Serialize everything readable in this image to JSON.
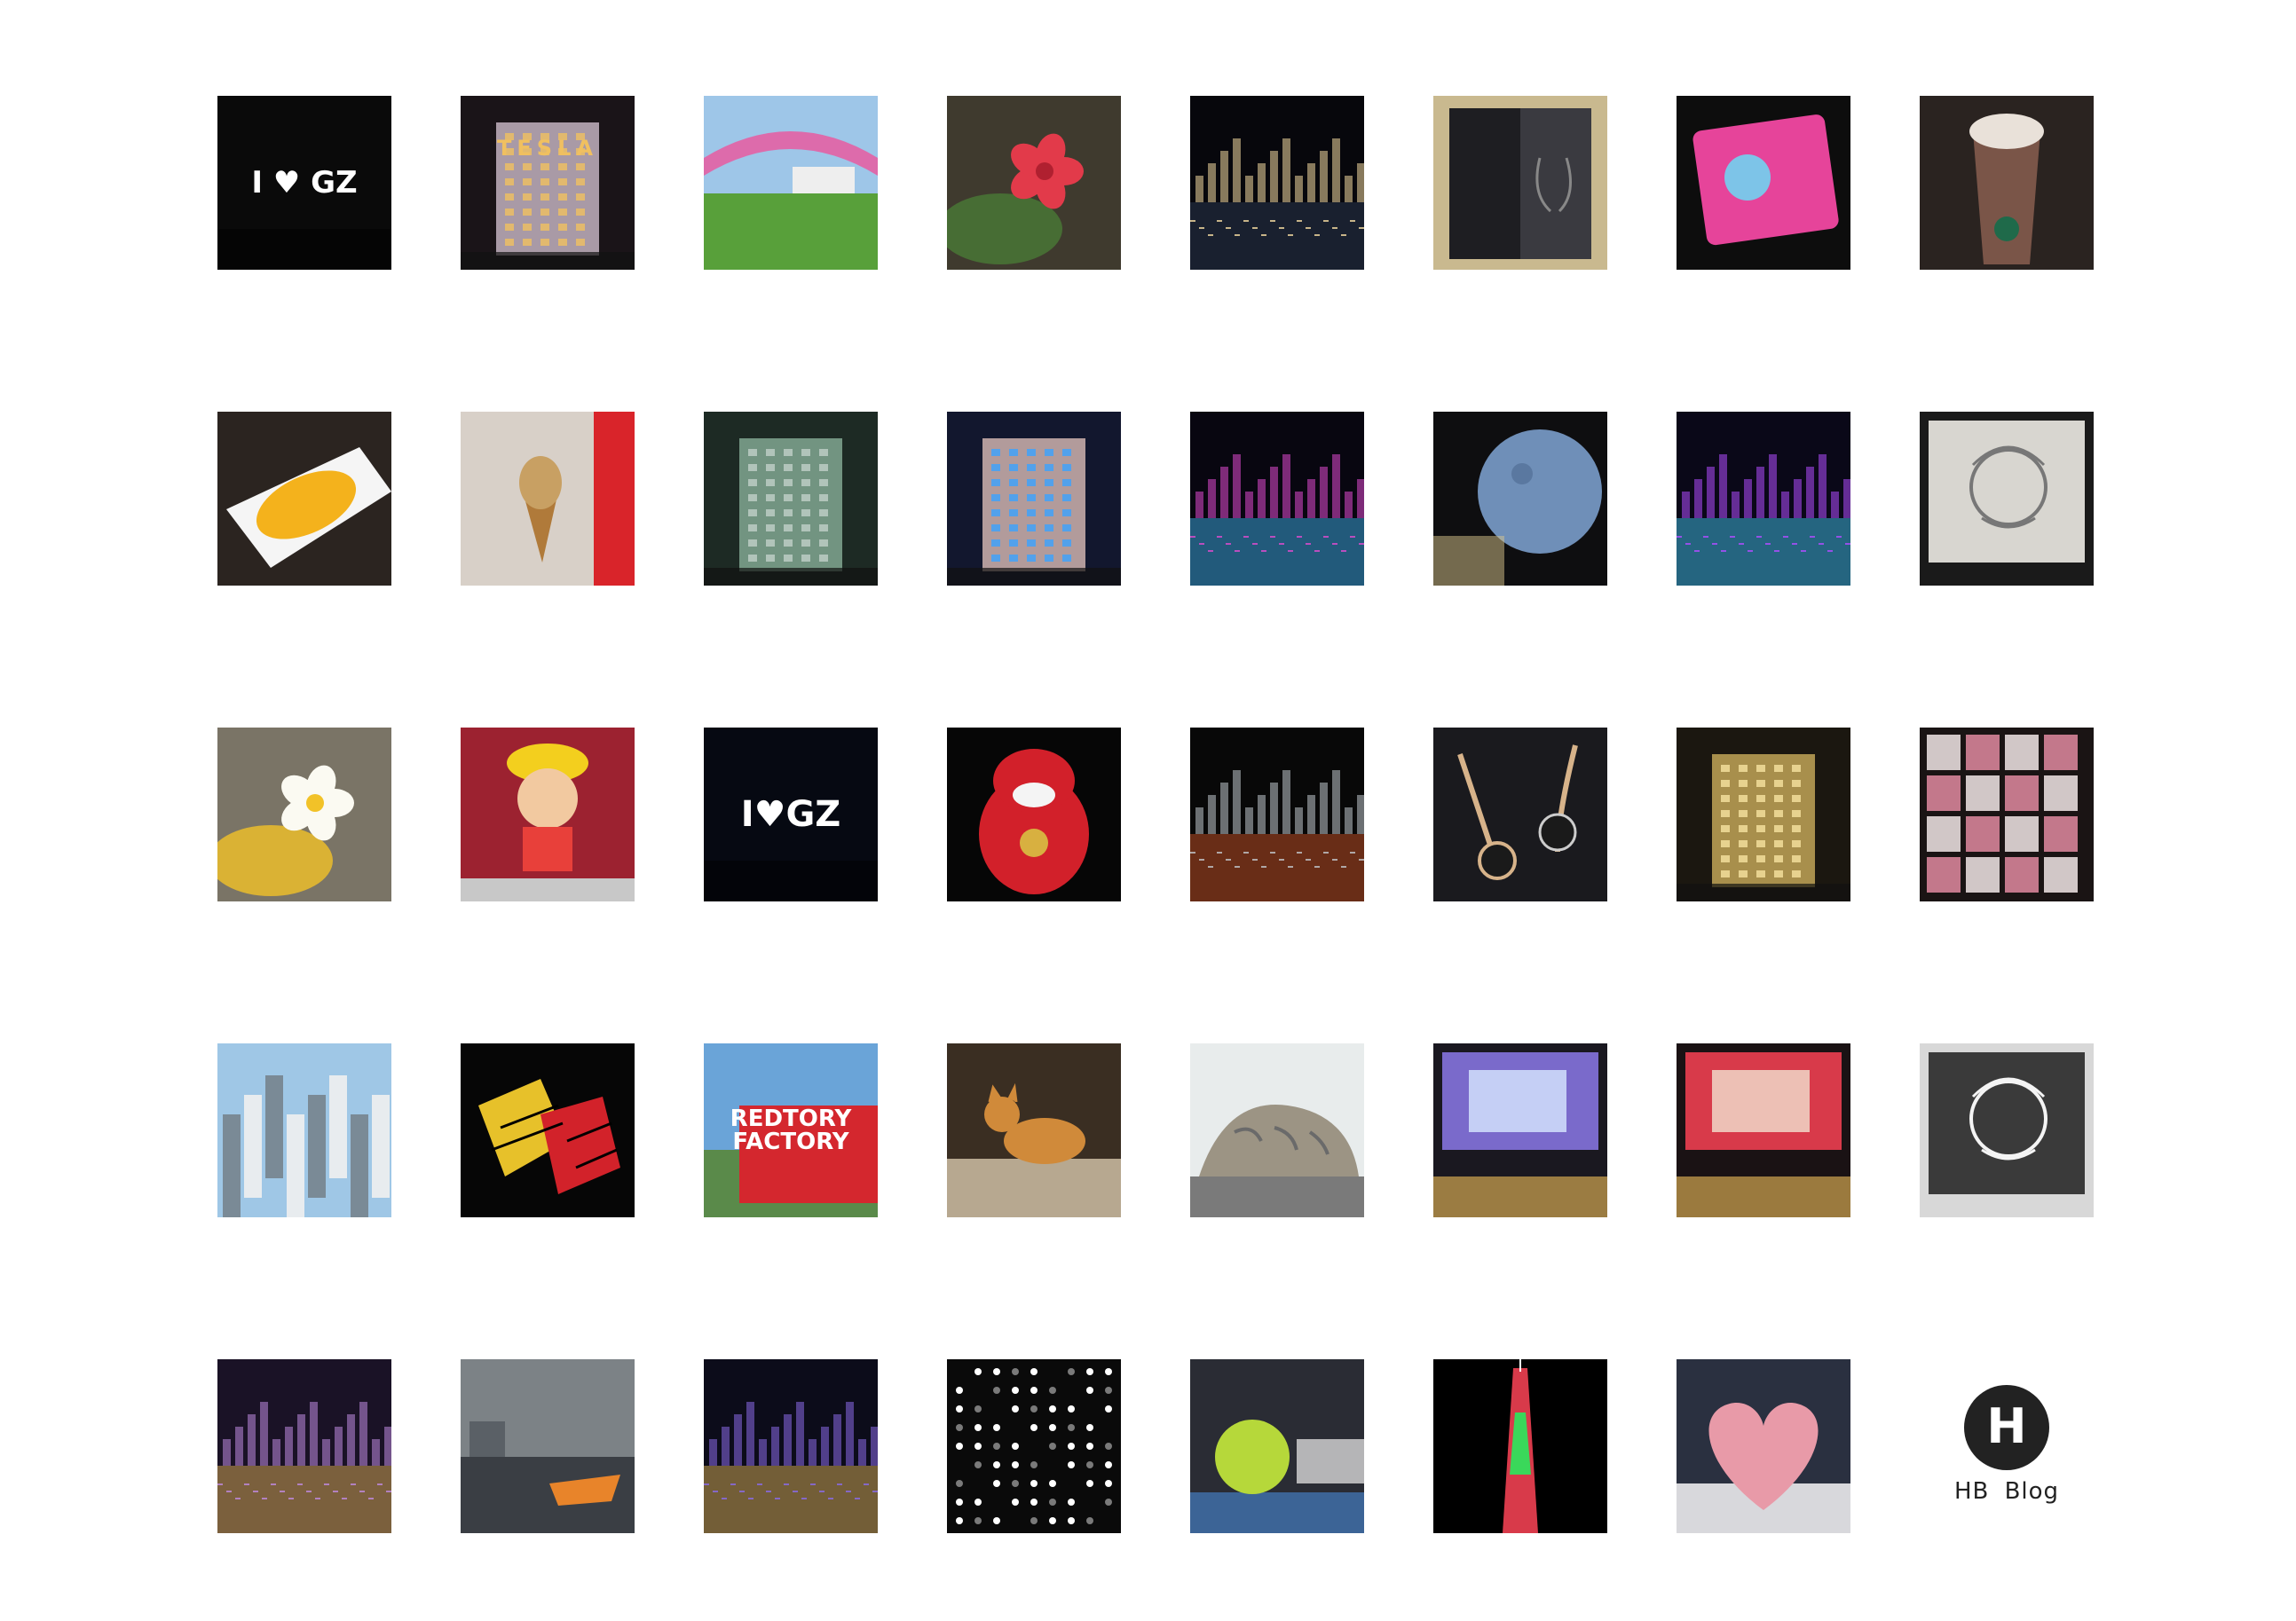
{
  "gallery": {
    "photos": [
      {
        "name": "i-love-gz-sign-photo",
        "bg": "#0a0a0a",
        "accent": "#ffffff",
        "accent2": "#e11b2b",
        "kind": "sign",
        "caption": "I ♥ GZ"
      },
      {
        "name": "tesla-store-photo",
        "bg": "#1a1418",
        "accent": "#d9c7d6",
        "accent2": "#f0c060",
        "kind": "building",
        "caption": "TESLA"
      },
      {
        "name": "rainbow-canopy-tram-photo",
        "bg": "#9ec6e8",
        "accent": "#58a03a",
        "accent2": "#e85aa0",
        "kind": "outdoor"
      },
      {
        "name": "red-flower-photo",
        "bg": "#3f3a2e",
        "accent": "#e23a4a",
        "accent2": "#4a7a36",
        "kind": "flower"
      },
      {
        "name": "river-night-skyline-photo",
        "bg": "#07070c",
        "accent": "#f3d9a0",
        "accent2": "#31405a",
        "kind": "night"
      },
      {
        "name": "earphone-box-photo",
        "bg": "#c9b98f",
        "accent": "#1e1e22",
        "accent2": "#3a3a40",
        "kind": "box"
      },
      {
        "name": "pink-card-photo",
        "bg": "#0d0d0d",
        "accent": "#e6449a",
        "accent2": "#7dc4e8",
        "kind": "card"
      },
      {
        "name": "starbucks-frappuccino-photo",
        "bg": "#2a2320",
        "accent": "#7a5548",
        "accent2": "#e9e1d9",
        "kind": "drink"
      },
      {
        "name": "mango-dessert-photo",
        "bg": "#2b2420",
        "accent": "#f4b21c",
        "accent2": "#f5f5f5",
        "kind": "food"
      },
      {
        "name": "ice-cream-cone-photo",
        "bg": "#d8d0c8",
        "accent": "#c8a063",
        "accent2": "#d9242a",
        "kind": "icecream"
      },
      {
        "name": "glass-tower-photo",
        "bg": "#1d2a24",
        "accent": "#8fb8a0",
        "accent2": "#c0cfc8",
        "kind": "building"
      },
      {
        "name": "hotel-tower-night-photo",
        "bg": "#12172e",
        "accent": "#e8c8c0",
        "accent2": "#3aa3ff",
        "kind": "building"
      },
      {
        "name": "bridge-night-lights-photo",
        "bg": "#080610",
        "accent": "#e04bd0",
        "accent2": "#43c0ff",
        "kind": "night"
      },
      {
        "name": "moon-lamp-photo",
        "bg": "#0e0e10",
        "accent": "#6f8fb8",
        "accent2": "#d9c68c",
        "kind": "moon"
      },
      {
        "name": "neon-ufo-pavilion-photo",
        "bg": "#0a0818",
        "accent": "#b04cff",
        "accent2": "#48d8ff",
        "kind": "night"
      },
      {
        "name": "pencil-sketch-photo",
        "bg": "#1a1a1a",
        "accent": "#d8d6d0",
        "accent2": "#777777",
        "kind": "sketch"
      },
      {
        "name": "frangipani-flower-photo",
        "bg": "#7a7466",
        "accent": "#fbfaf2",
        "accent2": "#f2c228",
        "kind": "flower"
      },
      {
        "name": "luffy-figure-photo",
        "bg": "#9c2230",
        "accent": "#f3cf1e",
        "accent2": "#e8403a",
        "kind": "figure"
      },
      {
        "name": "i-love-gz-tower-photo",
        "bg": "#060912",
        "accent": "#ffffff",
        "accent2": "#4a86d8",
        "kind": "sign",
        "caption": "I♥GZ"
      },
      {
        "name": "red-plush-toy-photo",
        "bg": "#060606",
        "accent": "#d2202a",
        "accent2": "#f4f4f4",
        "kind": "plush"
      },
      {
        "name": "apple-store-night-photo",
        "bg": "#080808",
        "accent": "#c0c6cc",
        "accent2": "#e05a2a",
        "kind": "night"
      },
      {
        "name": "in-ear-monitors-photo",
        "bg": "#1a1a1e",
        "accent": "#d7b38a",
        "accent2": "#2a2a2a",
        "kind": "earphones"
      },
      {
        "name": "clock-tower-building-photo",
        "bg": "#1b1710",
        "accent": "#d8b860",
        "accent2": "#f6e2a0",
        "kind": "building"
      },
      {
        "name": "yongqingfang-wall-photo",
        "bg": "#1a1414",
        "accent": "#e28aa0",
        "accent2": "#f2e6e6",
        "kind": "wall"
      },
      {
        "name": "apartment-towers-day-photo",
        "bg": "#9fc7e6",
        "accent": "#e8ecef",
        "accent2": "#7a8a96",
        "kind": "day"
      },
      {
        "name": "rubiks-cubes-photo",
        "bg": "#060606",
        "accent": "#e7c12a",
        "accent2": "#d2222a",
        "kind": "cubes"
      },
      {
        "name": "redtory-factory-photo",
        "bg": "#6aa4d8",
        "accent": "#d4272e",
        "accent2": "#ffffff",
        "kind": "redtory",
        "caption": "REDTORY\nFACTORY"
      },
      {
        "name": "orange-cat-photo",
        "bg": "#3a2e22",
        "accent": "#d08a3a",
        "accent2": "#b7a890",
        "kind": "cat"
      },
      {
        "name": "engraved-stone-photo",
        "bg": "#e8ecec",
        "accent": "#9c9484",
        "accent2": "#6a6a6a",
        "kind": "stone"
      },
      {
        "name": "nex-billboard-photo",
        "bg": "#1a1820",
        "accent": "#7a6acb",
        "accent2": "#d8e8ff",
        "kind": "billboard"
      },
      {
        "name": "shopping-street-billboards-photo",
        "bg": "#1a1214",
        "accent": "#d83a4a",
        "accent2": "#f2e2d0",
        "kind": "billboard"
      },
      {
        "name": "portrait-drawing-photo",
        "bg": "#d8d8d8",
        "accent": "#3a3a3a",
        "accent2": "#f4f4f4",
        "kind": "sketch"
      },
      {
        "name": "pedestrian-street-night-photo",
        "bg": "#1a1226",
        "accent": "#c08ae0",
        "accent2": "#f2c05a",
        "kind": "night"
      },
      {
        "name": "cloudy-river-boat-photo",
        "bg": "#7c8286",
        "accent": "#e8842a",
        "accent2": "#3a3e44",
        "kind": "river"
      },
      {
        "name": "canton-skyline-night-photo",
        "bg": "#0c0c1a",
        "accent": "#8a6ae8",
        "accent2": "#f2c45a",
        "kind": "night"
      },
      {
        "name": "led-dot-wall-photo",
        "bg": "#0a0a0a",
        "accent": "#ffffff",
        "accent2": "#7a7a7a",
        "kind": "dots"
      },
      {
        "name": "lit-tree-park-photo",
        "bg": "#2a2c34",
        "accent": "#b6d83a",
        "accent2": "#4a8ad8",
        "kind": "park"
      },
      {
        "name": "canton-tower-photo",
        "bg": "#000000",
        "accent": "#d83a4a",
        "accent2": "#3ad85a",
        "kind": "tower"
      },
      {
        "name": "origami-heart-photo",
        "bg": "#2a3040",
        "accent": "#e89aa8",
        "accent2": "#f4d8dc",
        "kind": "heart"
      }
    ],
    "brand": {
      "logo_letter": "H",
      "text": "HB Blog",
      "color": "#222222"
    }
  }
}
